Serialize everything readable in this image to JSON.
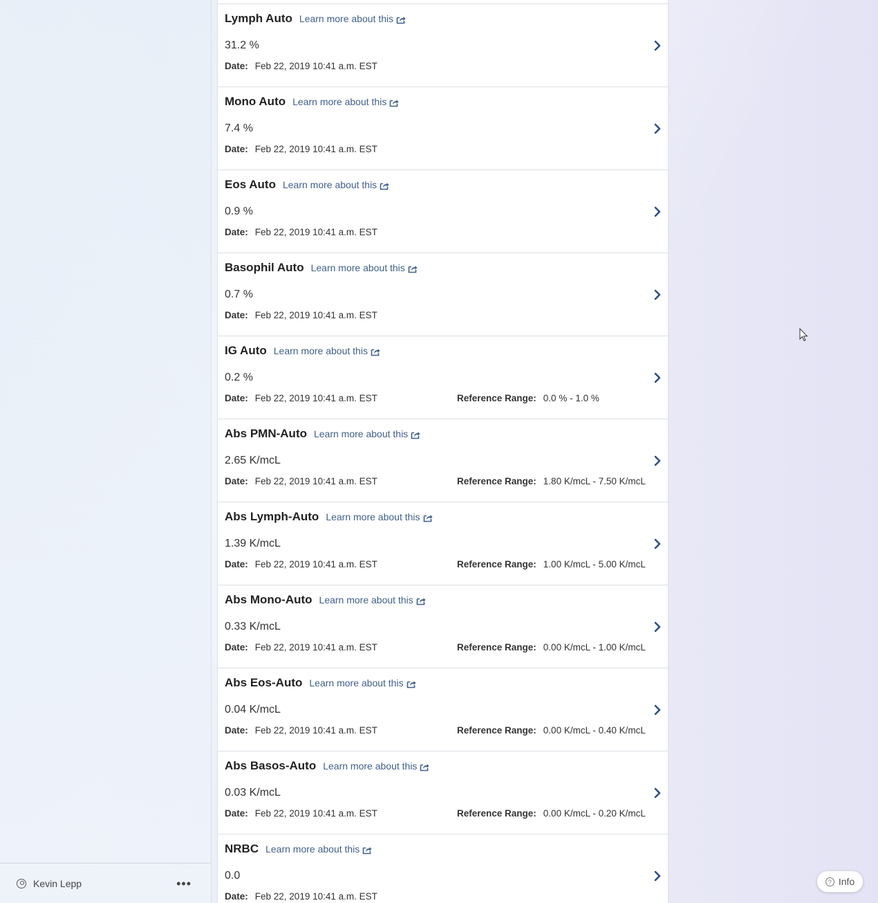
{
  "sidebar": {
    "user_name": "Kevin Lepp",
    "more_label": "•••"
  },
  "info_button": {
    "label": "Info",
    "glyph": "?"
  },
  "learn_more_label": "Learn more about this",
  "date_label": "Date:",
  "ref_label": "Reference Range:",
  "accent_color": "#2c4f8a",
  "results": [
    {
      "name": "Lymph Auto",
      "value": "31.2 %",
      "date": "Feb 22, 2019 10:41 a.m. EST",
      "range": ""
    },
    {
      "name": "Mono Auto",
      "value": "7.4 %",
      "date": "Feb 22, 2019 10:41 a.m. EST",
      "range": ""
    },
    {
      "name": "Eos Auto",
      "value": "0.9 %",
      "date": "Feb 22, 2019 10:41 a.m. EST",
      "range": ""
    },
    {
      "name": "Basophil Auto",
      "value": "0.7 %",
      "date": "Feb 22, 2019 10:41 a.m. EST",
      "range": ""
    },
    {
      "name": "IG Auto",
      "value": "0.2 %",
      "date": "Feb 22, 2019 10:41 a.m. EST",
      "range": "0.0 % - 1.0 %"
    },
    {
      "name": "Abs PMN-Auto",
      "value": "2.65 K/mcL",
      "date": "Feb 22, 2019 10:41 a.m. EST",
      "range": "1.80 K/mcL - 7.50 K/mcL"
    },
    {
      "name": "Abs Lymph-Auto",
      "value": "1.39 K/mcL",
      "date": "Feb 22, 2019 10:41 a.m. EST",
      "range": "1.00 K/mcL - 5.00 K/mcL"
    },
    {
      "name": "Abs Mono-Auto",
      "value": "0.33 K/mcL",
      "date": "Feb 22, 2019 10:41 a.m. EST",
      "range": "0.00 K/mcL - 1.00 K/mcL"
    },
    {
      "name": "Abs Eos-Auto",
      "value": "0.04 K/mcL",
      "date": "Feb 22, 2019 10:41 a.m. EST",
      "range": "0.00 K/mcL - 0.40 K/mcL"
    },
    {
      "name": "Abs Basos-Auto",
      "value": "0.03 K/mcL",
      "date": "Feb 22, 2019 10:41 a.m. EST",
      "range": "0.00 K/mcL - 0.20 K/mcL"
    },
    {
      "name": "NRBC",
      "value": "0.0",
      "date": "Feb 22, 2019 10:41 a.m. EST",
      "range": ""
    }
  ]
}
